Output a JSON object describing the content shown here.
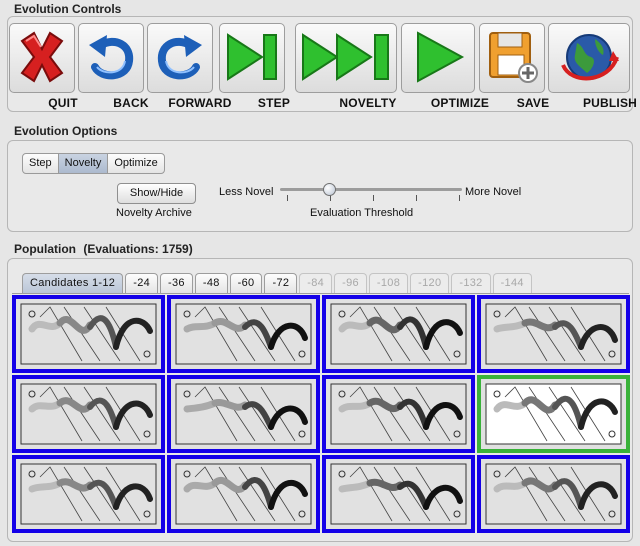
{
  "controls": {
    "title": "Evolution Controls",
    "buttons": [
      {
        "id": "quit",
        "label": "QUIT",
        "icon": "quit-x-icon"
      },
      {
        "id": "back",
        "label": "BACK",
        "icon": "back-arrow-icon"
      },
      {
        "id": "forward",
        "label": "FORWARD",
        "icon": "forward-arrow-icon"
      },
      {
        "id": "step",
        "label": "STEP",
        "icon": "step-icon"
      },
      {
        "id": "novelty",
        "label": "NOVELTY",
        "icon": "double-step-icon"
      },
      {
        "id": "optimize",
        "label": "OPTIMIZE",
        "icon": "play-icon"
      },
      {
        "id": "save",
        "label": "SAVE",
        "icon": "floppy-disk-icon"
      },
      {
        "id": "publish",
        "label": "PUBLISH",
        "icon": "globe-icon"
      }
    ]
  },
  "options": {
    "title": "Evolution Options",
    "modes": [
      "Step",
      "Novelty",
      "Optimize"
    ],
    "active_mode": "Novelty",
    "show_hide_label": "Show/Hide",
    "archive_label": "Novelty Archive",
    "less_novel_label": "Less Novel",
    "more_novel_label": "More Novel",
    "threshold_label": "Evaluation Threshold",
    "threshold_fraction": 0.27
  },
  "population": {
    "title": "Population",
    "evaluations_label": "(Evaluations: 1759)",
    "tabs": [
      {
        "label": "Candidates 1-12",
        "state": "active"
      },
      {
        "label": "-24",
        "state": "enabled"
      },
      {
        "label": "-36",
        "state": "enabled"
      },
      {
        "label": "-48",
        "state": "enabled"
      },
      {
        "label": "-60",
        "state": "enabled"
      },
      {
        "label": "-72",
        "state": "enabled"
      },
      {
        "label": "-84",
        "state": "disabled"
      },
      {
        "label": "-96",
        "state": "disabled"
      },
      {
        "label": "-108",
        "state": "disabled"
      },
      {
        "label": "-120",
        "state": "disabled"
      },
      {
        "label": "-132",
        "state": "disabled"
      },
      {
        "label": "-144",
        "state": "disabled"
      }
    ],
    "candidate_count": 12,
    "selected_candidate": 8
  },
  "colors": {
    "candidate_border": "#1400e8",
    "selected_border": "#3ab23a",
    "step_green": "#2fc02f",
    "quit_red": "#d62020"
  }
}
